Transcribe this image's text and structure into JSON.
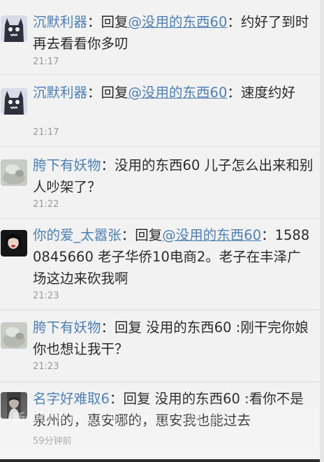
{
  "posts": [
    {
      "user": "沉默利器",
      "reply_prefix": "：回复",
      "mention": "@没用的东西60",
      "text": "：约好了到时再去看看你多叨",
      "time": "21:17"
    },
    {
      "user": "沉默利器",
      "reply_prefix": "：回复",
      "mention": "@没用的东西60",
      "text": "：速度约好",
      "time": "21:17"
    },
    {
      "user": "胯下有妖物",
      "reply_prefix": "：",
      "mention": "",
      "text": "没用的东西60 儿子怎么出来和别人吵架了？",
      "time": "21:22"
    },
    {
      "user": "你的爱_太嚣张",
      "reply_prefix": "：回复",
      "mention": "@没用的东西60",
      "text": "：15880845660 老子华侨10电商2。老子在丰泽广场这边来砍我啊",
      "time": "21:23"
    },
    {
      "user": "胯下有妖物",
      "reply_prefix": "：",
      "mention": "",
      "text": "回复 没用的东西60 :刚干完你娘 你也想让我干？",
      "time": "21:23"
    },
    {
      "user": "名字好难取6",
      "reply_prefix": "：",
      "mention": "",
      "text": "回复 没用的东西60 :看你不是泉州的，惠安哪的，惠安我也能过去",
      "time": "59分钟前"
    }
  ],
  "watermark": "新浪微博 m.weibo.com/u 来自 录..."
}
